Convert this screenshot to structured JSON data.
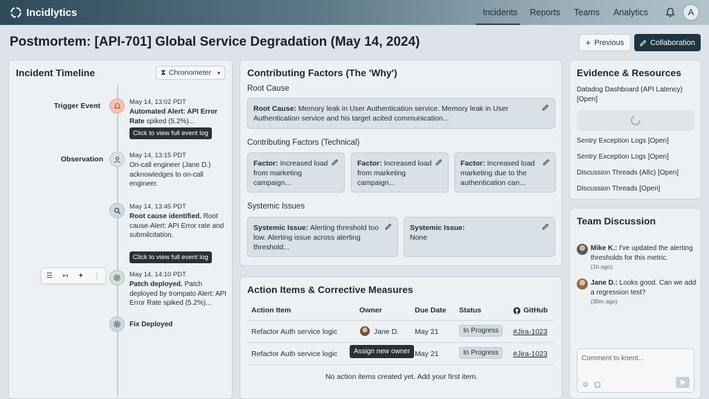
{
  "app": {
    "name": "Incidlytics"
  },
  "nav": {
    "items": [
      "Incidents",
      "Reports",
      "Teams",
      "Analytics"
    ],
    "avatar_initial": "A"
  },
  "page": {
    "title": "Postmortem: [API-701] Global Service Degradation (May 14, 2024)",
    "previous_label": "Previous",
    "collab_label": "Collaboration"
  },
  "timeline": {
    "title": "Incident Timeline",
    "sort_label": "Chronometer",
    "tooltip": "Click to view full event log",
    "events": [
      {
        "label": "Trigger Event",
        "time": "May 14, 13:02 PDT",
        "bold": "Automated Alert: API Error Rate",
        "rest": " spiked (5.2%)..."
      },
      {
        "label": "Observation",
        "time": "May 14, 13:15 PDT",
        "bold": "",
        "rest": "On-call engineer (Jane D.) acknowledges to on-call engineer."
      },
      {
        "label": "",
        "time": "May 14, 13:45 PDT",
        "bold": "Root cause identified.",
        "rest": " Root cause-Alert: API Error rate and submilcitation."
      },
      {
        "label": "",
        "time": "May 14, 14:10 PDT",
        "bold": "Patch deployed.",
        "rest": " Patch deployed by trompato Alert: API Error Rate spiked (5.2%)..."
      },
      {
        "label": "",
        "time": "",
        "bold": "Fix Deployed",
        "rest": ""
      }
    ]
  },
  "factors": {
    "title": "Contributing Factors (The 'Why')",
    "root_cause_heading": "Root Cause",
    "root_cause_label": "Root Cause:",
    "root_cause_text": " Memory leak in User Authentication service. Memory leak in User Authentication service and his target acited communication...",
    "technical_heading": "Contributing Factors (Technical)",
    "technical": [
      {
        "label": "Factor:",
        "text": " Increased load from marketing campaign..."
      },
      {
        "label": "Factor:",
        "text": " Increased load from marketing campaign..."
      },
      {
        "label": "Factor:",
        "text": " Increased load marketing due to the authentication can..."
      }
    ],
    "systemic_heading": "Systemic Issues",
    "systemic": [
      {
        "label": "Systemic Issue:",
        "text": " Alerting threshold too low. Alerting issue across alerting threshold..."
      },
      {
        "label": "Systemic Issue:",
        "text": " None"
      }
    ]
  },
  "actions": {
    "title": "Action Items & Corrective Measures",
    "columns": [
      "Action Item",
      "Owner",
      "Due Date",
      "Status",
      "GitHub"
    ],
    "rows": [
      {
        "item": "Refactor Auth service logic",
        "owner": "Jane D.",
        "due": "May 21",
        "status": "In Progress",
        "link": "#Jira-1023"
      },
      {
        "item": "Refactor Auth service logic",
        "owner": "",
        "due": "May 21",
        "status": "In Progress",
        "link": "#Jira-1023"
      }
    ],
    "assign_tooltip": "Assign new owner",
    "empty_text": "No action items created yet. Add your first item."
  },
  "evidence": {
    "title": "Evidence & Resources",
    "items": [
      "Datadog Dashboard (API Latency) [Open]",
      "Sentry Exception Logs [Open]",
      "Sentry Exception Logs [Open]",
      "Discussion Threads (A8c) [Open]",
      "Discussion Threads [Open]"
    ]
  },
  "discussion": {
    "title": "Team Discussion",
    "messages": [
      {
        "author": "Mike K.:",
        "text": " I've updated the alerting thresholds for this metric.",
        "time": "(1h ago)"
      },
      {
        "author": "Jane D.:",
        "text": " Looks good. Can we add a regression test?",
        "time": "(30m ago)"
      }
    ],
    "comment_placeholder": "Comment to knent..."
  },
  "colors": {
    "accent": "#1e3442",
    "topbar_dark": "#2f4a58",
    "trigger_node": "#f2c3b4",
    "node": "#cfd9e0"
  }
}
